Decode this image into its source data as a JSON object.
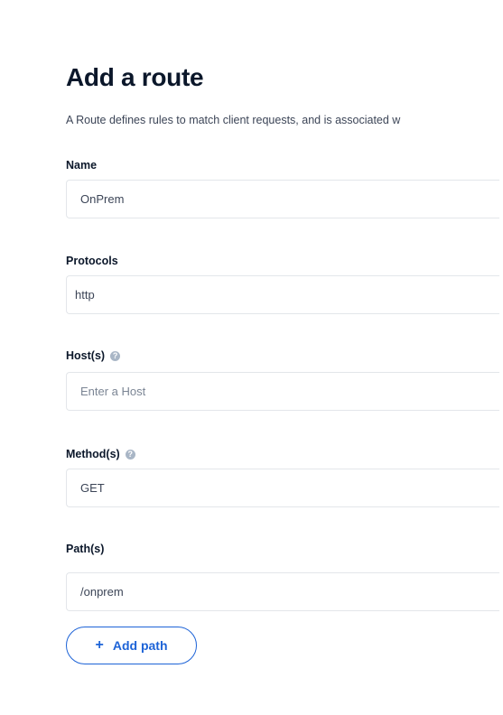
{
  "page": {
    "title": "Add a route",
    "description": "A Route defines rules to match client requests, and is associated w"
  },
  "form": {
    "name": {
      "label": "Name",
      "value": "OnPrem"
    },
    "protocols": {
      "label": "Protocols",
      "value": "http"
    },
    "hosts": {
      "label": "Host(s)",
      "value": "",
      "placeholder": "Enter a Host",
      "help_icon": "question-circle-icon"
    },
    "methods": {
      "label": "Method(s)",
      "value": "GET",
      "help_icon": "question-circle-icon"
    },
    "paths": {
      "label": "Path(s)",
      "value": "/onprem"
    },
    "add_path": {
      "icon": "plus-icon",
      "icon_glyph": "+",
      "label": "Add path"
    }
  },
  "colors": {
    "accent": "#1d63d7",
    "heading": "#0b172a",
    "border": "#e3e6ea",
    "help_icon": "#a9b6c6"
  }
}
